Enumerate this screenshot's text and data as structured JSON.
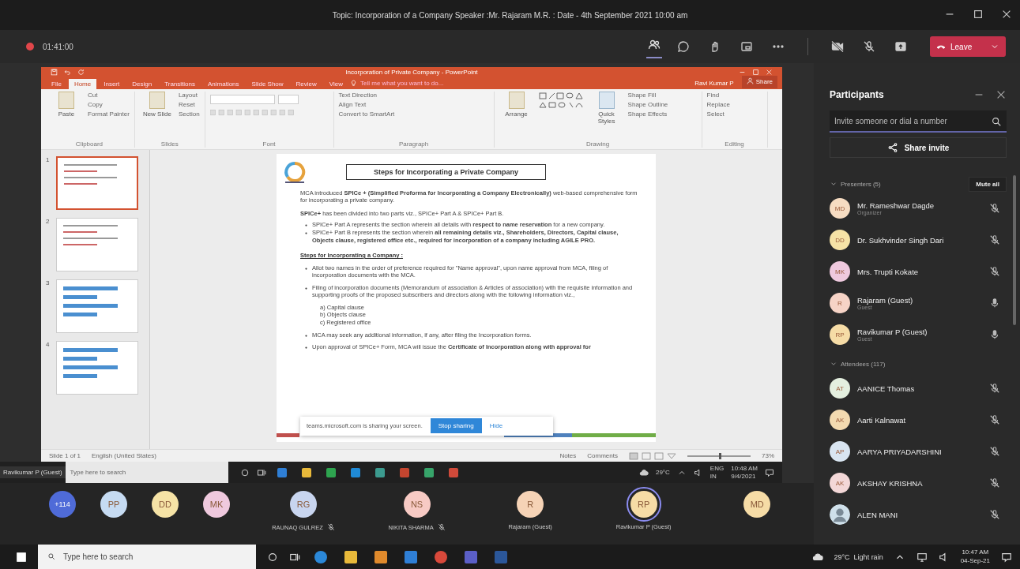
{
  "window": {
    "title": "Topic: Incorporation of a Company Speaker :Mr. Rajaram M.R. : Date - 4th September 2021 10:00 am"
  },
  "meeting_bar": {
    "timer": "01:41:00",
    "recording": true,
    "participants_selected": true,
    "leave_label": "Leave"
  },
  "powerpoint": {
    "title": "Incorporation of Private Company - PowerPoint",
    "tabs": [
      {
        "label": "File",
        "selected": false
      },
      {
        "label": "Home",
        "selected": true
      },
      {
        "label": "Insert",
        "selected": false
      },
      {
        "label": "Design",
        "selected": false
      },
      {
        "label": "Transitions",
        "selected": false
      },
      {
        "label": "Animations",
        "selected": false
      },
      {
        "label": "Slide Show",
        "selected": false
      },
      {
        "label": "Review",
        "selected": false
      },
      {
        "label": "View",
        "selected": false
      }
    ],
    "tell_me": "Tell me what you want to do...",
    "user": "Ravi Kumar P",
    "share_label": "Share",
    "ribbon_groups": [
      {
        "name": "Clipboard",
        "kind": "buttons",
        "big": "Paste",
        "items": [
          "Cut",
          "Copy",
          "Format Painter"
        ]
      },
      {
        "name": "Slides",
        "kind": "buttons",
        "big": "New Slide",
        "items": [
          "Layout",
          "Reset",
          "Section"
        ]
      },
      {
        "name": "Font",
        "kind": "font"
      },
      {
        "name": "Paragraph",
        "kind": "paragraph",
        "items": [
          "Text Direction",
          "Align Text",
          "Convert to SmartArt"
        ]
      },
      {
        "name": "Drawing",
        "kind": "drawing",
        "big": "Arrange",
        "big2": "Quick Styles",
        "items": [
          "Shape Fill",
          "Shape Outline",
          "Shape Effects"
        ]
      },
      {
        "name": "Editing",
        "kind": "buttons",
        "items": [
          "Find",
          "Replace",
          "Select"
        ]
      }
    ],
    "thumbnails": [
      {
        "number": "1",
        "selected": true
      },
      {
        "number": "2",
        "selected": false
      },
      {
        "number": "3",
        "selected": false
      },
      {
        "number": "4",
        "selected": false
      }
    ],
    "slide": {
      "title": "Steps for Incorporating a Private Company",
      "intro": "MCA introduced **SPICe + (Simplified Proforma for Incorporating a Company Electronically)** web-based comprehensive form for incorporating a private company.",
      "parts": "**SPICe+** has been divided into two parts viz., SPICe+ Part A & SPICe+ Part B.",
      "part_bullets": [
        "SPICe+ Part A represents the section wherein all details with **respect to name reservation** for a new company.",
        "SPICe+ Part B represents the section wherein **all remaining details viz., Shareholders, Directors, Capital clause, Objects clause, registered office etc., required for incorporation of a company including AGILE PRO.**"
      ],
      "steps_heading": "Steps for Incorporating a Company :",
      "steps": [
        {
          "text": "Allot two names in the order of preference required for \"Name approval\", upon name approval from MCA, filing of incorporation documents with the MCA."
        },
        {
          "text": "Filing of incorporation documents (Memorandum of association & Articles of association) with the requisite information and supporting proofs of the proposed subscribers and directors along with the following information viz.,",
          "sub": [
            "a) Capital clause",
            "b) Objects clause",
            "c) Registered office"
          ]
        },
        {
          "text": "MCA may seek any additional information, if any, after filing the Incorporation forms."
        },
        {
          "text": "Upon approval of SPICe+ Form, MCA will issue the **Certificate of Incorporation along with approval for**"
        }
      ]
    },
    "sharing_banner": {
      "message": "teams.microsoft.com is sharing your screen.",
      "stop_label": "Stop sharing",
      "hide_label": "Hide"
    },
    "status": {
      "slide": "Slide 1 of 1",
      "language": "English (United States)",
      "notes": "Notes",
      "comments": "Comments",
      "zoom": {
        "level": 0.5,
        "reading": "73%"
      }
    }
  },
  "presenter_taskbar": {
    "name_tag": "Ravikumar P (Guest)",
    "search_placeholder": "Type here to search",
    "temperature": "29°C",
    "lang_1": "ENG",
    "lang_2": "IN",
    "time": "10:48 AM",
    "date": "9/4/2021"
  },
  "video_strip": {
    "overflow": "+114",
    "avatars": [
      {
        "initials": "PP",
        "color": "#c6dbf2"
      },
      {
        "initials": "DD",
        "color": "#f6e3a6"
      },
      {
        "initials": "MK",
        "color": "#efc9de"
      }
    ],
    "tiles": [
      {
        "initials": "RG",
        "name": "RAUNAQ GULREZ",
        "muted": true,
        "speaking": false,
        "color": "#c8d5ef"
      },
      {
        "initials": "NS",
        "name": "NIKITA SHARMA",
        "muted": true,
        "speaking": false,
        "color": "#f7cac4"
      },
      {
        "initials": "R",
        "name": "Rajaram (Guest)",
        "speaking": false,
        "color": "#f6d3b6"
      },
      {
        "initials": "RP",
        "name": "Ravikumar P (Guest)",
        "speaking": true,
        "color": "#f6dca6"
      },
      {
        "initials": "MD",
        "color": "#f6dca6",
        "speaking": false
      }
    ]
  },
  "participants": {
    "title": "Participants",
    "search_placeholder": "Invite someone or dial a number",
    "share_invite": "Share invite",
    "sections": [
      {
        "label": "Presenters (5)",
        "mute_all": "Mute all",
        "people": [
          {
            "kind": "initials",
            "initials": "MD",
            "name": "Mr. Rameshwar Dagde",
            "role": "Organizer",
            "muted": true,
            "color": "#f6dcc2"
          },
          {
            "kind": "initials",
            "initials": "DD",
            "name": "Dr. Sukhvinder Singh Dari",
            "muted": true,
            "color": "#f6e3a6"
          },
          {
            "kind": "initials",
            "initials": "MK",
            "name": "Mrs. Trupti Kokate",
            "muted": true,
            "color": "#efc9de"
          },
          {
            "kind": "initials",
            "initials": "R",
            "name": "Rajaram (Guest)",
            "role": "Guest",
            "muted": false,
            "color": "#f6d3c6"
          },
          {
            "kind": "initials",
            "initials": "RP",
            "name": "Ravikumar P (Guest)",
            "role": "Guest",
            "muted": false,
            "color": "#f6dca6"
          }
        ]
      },
      {
        "label": "Attendees (117)",
        "people": [
          {
            "kind": "initials",
            "initials": "AT",
            "name": "AANICE Thomas",
            "muted": true,
            "color": "#e4efdf"
          },
          {
            "kind": "initials",
            "initials": "AK",
            "name": "Aarti Kalnawat",
            "muted": true,
            "color": "#f3dab0"
          },
          {
            "kind": "initials",
            "initials": "AP",
            "name": "AARYA PRIYADARSHINI",
            "muted": true,
            "color": "#d9e5f1"
          },
          {
            "kind": "initials",
            "initials": "AK",
            "name": "AKSHAY KRISHNA",
            "muted": true,
            "color": "#f3d7d7"
          },
          {
            "kind": "picture",
            "name": "ALEN MANI",
            "muted": true,
            "color": "#cfe0ea"
          }
        ]
      }
    ]
  },
  "taskbar": {
    "search_placeholder": "Type here to search",
    "weather": "29°C  Light rain",
    "time": "10:47 AM",
    "date": "04-Sep-21"
  }
}
